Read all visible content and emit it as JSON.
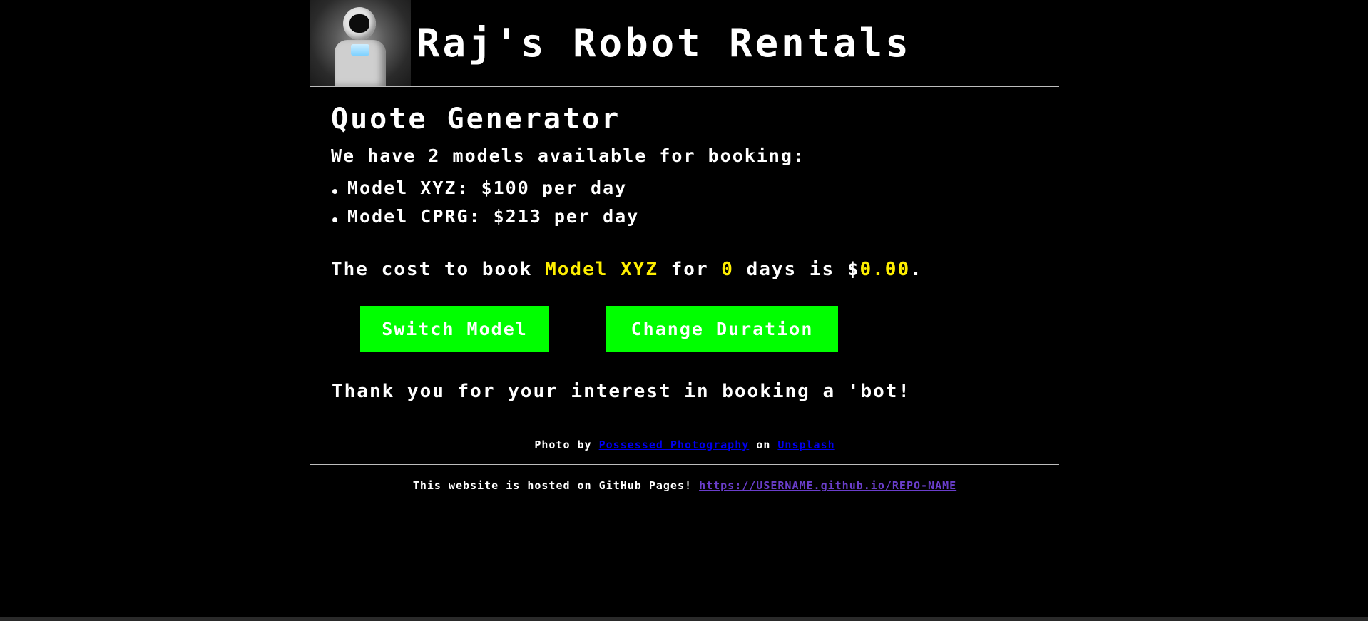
{
  "header": {
    "logo_alt": "robot photo",
    "title": "Raj's Robot Rentals"
  },
  "main": {
    "section_title": "Quote Generator",
    "intro": "We have 2 models available for booking:",
    "models": [
      {
        "label": "Model XYZ: $100 per day"
      },
      {
        "label": "Model CPRG: $213 per day"
      }
    ],
    "cost": {
      "prefix": "The cost to book ",
      "model": "Model XYZ",
      "mid1": " for ",
      "days": "0",
      "mid2": " days is $",
      "amount": "0.00",
      "suffix": "."
    },
    "buttons": {
      "switch_model": "Switch Model",
      "change_duration": "Change Duration"
    },
    "thanks": "Thank you for your interest in booking a 'bot!"
  },
  "footer": {
    "credit_prefix": "Photo by ",
    "photographer": "Possessed Photography",
    "credit_mid": " on ",
    "source": "Unsplash",
    "hosted_text": "This website is hosted on GitHub Pages! ",
    "hosted_link": "https://USERNAME.github.io/REPO-NAME"
  },
  "colors": {
    "background": "#000000",
    "text": "#ffffff",
    "highlight": "#ffef00",
    "button": "#00ff00",
    "link": "#0000ee",
    "visited_link": "#6a3ecb"
  }
}
